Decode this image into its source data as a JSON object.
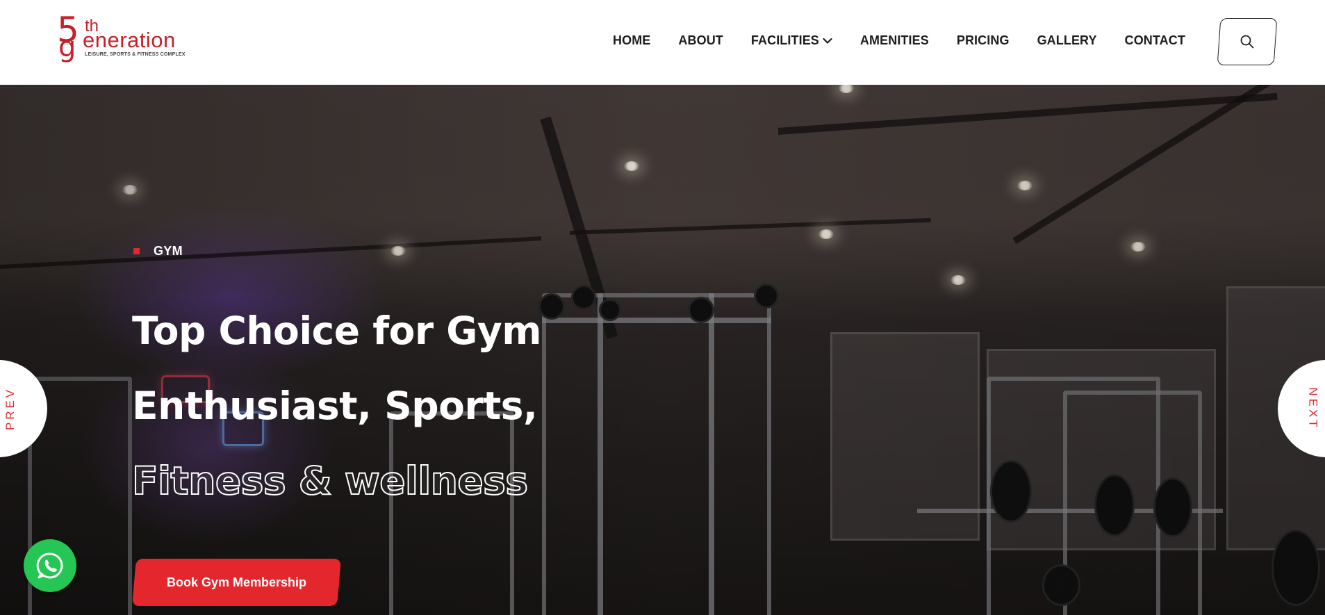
{
  "logo": {
    "five": "5",
    "g": "g",
    "th": "th",
    "eneration": "eneration",
    "tagline": "LEISURE, SPORTS & FITNESS COMPLEX",
    "brand_color": "#c8202a"
  },
  "nav": {
    "items": [
      {
        "label": "HOME"
      },
      {
        "label": "ABOUT"
      },
      {
        "label": "FACILITIES",
        "has_dropdown": true
      },
      {
        "label": "AMENITIES"
      },
      {
        "label": "PRICING"
      },
      {
        "label": "GALLERY"
      },
      {
        "label": "CONTACT"
      }
    ],
    "search_icon": "search-icon"
  },
  "hero": {
    "tag": "GYM",
    "headline": [
      "Top Choice for Gym",
      "Enthusiast, Sports,",
      "Fitness & wellness"
    ],
    "cta_label": "Book Gym Membership",
    "prev_label": "PREV",
    "next_label": "NEXT",
    "accent_color": "#e3272d",
    "whatsapp_icon": "whatsapp-icon",
    "whatsapp_color": "#25c653"
  }
}
